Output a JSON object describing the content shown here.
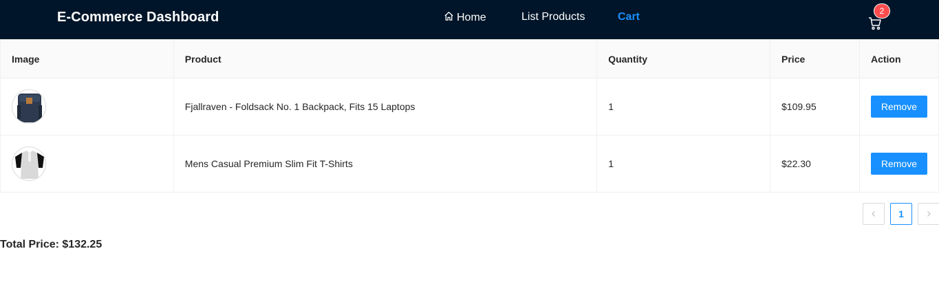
{
  "header": {
    "brand": "E-Commerce Dashboard",
    "nav": {
      "home": "Home",
      "list_products": "List Products",
      "cart": "Cart"
    },
    "cart_badge": "2",
    "icons": {
      "home": "home-icon",
      "cart": "shopping-cart-icon"
    },
    "colors": {
      "background": "#001529",
      "active": "#1890ff",
      "badge": "#ff4d4f"
    }
  },
  "table": {
    "columns": [
      "Image",
      "Product",
      "Quantity",
      "Price",
      "Action"
    ],
    "rows": [
      {
        "product": "Fjallraven - Foldsack No. 1 Backpack, Fits 15 Laptops",
        "quantity": "1",
        "price": "$109.95",
        "action": "Remove"
      },
      {
        "product": "Mens Casual Premium Slim Fit T-Shirts",
        "quantity": "1",
        "price": "$22.30",
        "action": "Remove"
      }
    ]
  },
  "pagination": {
    "current": "1"
  },
  "total": {
    "label": "Total Price: $132.25"
  }
}
